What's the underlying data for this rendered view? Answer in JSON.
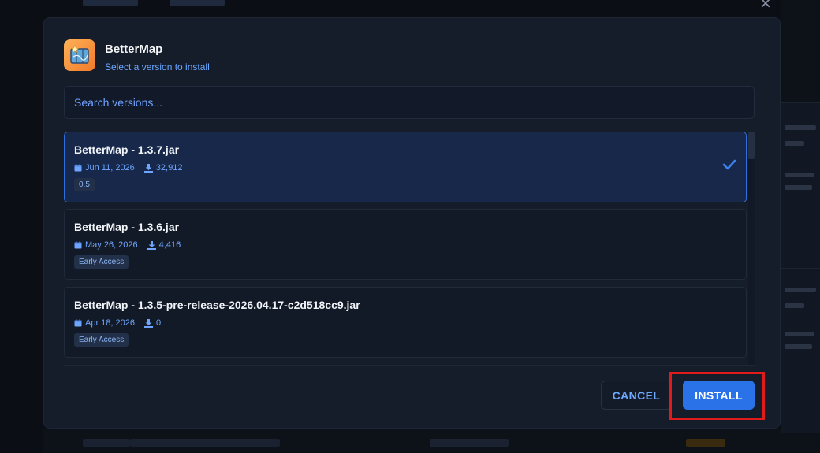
{
  "modal": {
    "title": "BetterMap",
    "subtitle": "Select a version to install",
    "icon": "map-icon",
    "search": {
      "placeholder": "Search versions...",
      "value": ""
    }
  },
  "versions": [
    {
      "name": "BetterMap - 1.3.7.jar",
      "date": "Jun 11, 2026",
      "downloads": "32,912",
      "tag": "0.5",
      "selected": true
    },
    {
      "name": "BetterMap - 1.3.6.jar",
      "date": "May 26, 2026",
      "downloads": "4,416",
      "tag": "Early Access",
      "selected": false
    },
    {
      "name": "BetterMap - 1.3.5-pre-release-2026.04.17-c2d518cc9.jar",
      "date": "Apr 18, 2026",
      "downloads": "0",
      "tag": "Early Access",
      "selected": false
    }
  ],
  "actions": {
    "cancel_label": "CANCEL",
    "install_label": "INSTALL"
  },
  "colors": {
    "accent": "#2a72e8",
    "link": "#6aa7ff",
    "highlight": "#e01b1b",
    "surface": "#161d2a"
  }
}
